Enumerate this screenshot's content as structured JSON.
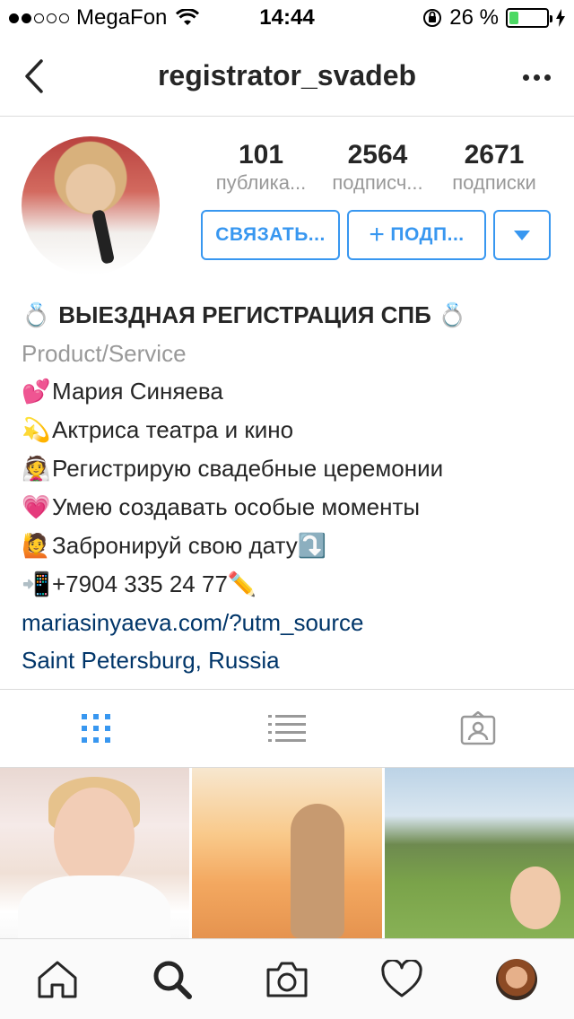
{
  "status_bar": {
    "carrier": "MegaFon",
    "signal_bars_filled": 2,
    "signal_bars_total": 5,
    "time": "14:44",
    "battery_percent_text": "26 %",
    "battery_level": 0.26,
    "battery_color": "#4cd964"
  },
  "nav": {
    "title": "registrator_svadeb",
    "back_icon": "chevron-left-icon",
    "more_icon": "more-horizontal-icon"
  },
  "profile": {
    "stats": [
      {
        "value": "101",
        "label": "публика..."
      },
      {
        "value": "2564",
        "label": "подписч..."
      },
      {
        "value": "2671",
        "label": "подписки"
      }
    ],
    "contact_button": "СВЯЗАТЬ...",
    "follow_button": "ПОДП...",
    "follow_plus": "+",
    "accent_color": "#3897f0"
  },
  "bio": {
    "name": "ВЫЕЗДНАЯ РЕГИСТРАЦИЯ СПБ",
    "name_emoji": "💍",
    "category": "Product/Service",
    "lines": [
      {
        "emoji": "💕",
        "text": "Мария Синяева"
      },
      {
        "emoji": "💫",
        "text": "Актриса театра и кино"
      },
      {
        "emoji": "👰",
        "text": "Регистрирую свадебные церемонии"
      },
      {
        "emoji": "💗",
        "text": "Умею создавать особые моменты"
      },
      {
        "emoji": "🙋",
        "text": "Забронируй свою дату",
        "suffix": "⤵️"
      },
      {
        "emoji": "📲",
        "text": "+7904 335 24 77",
        "suffix": "✏️"
      }
    ],
    "website": "mariasinyaeva.com/?utm_source",
    "location": "Saint Petersburg, Russia",
    "link_color": "#003569"
  },
  "tabs": [
    {
      "icon": "grid-icon",
      "active": true
    },
    {
      "icon": "list-icon",
      "active": false
    },
    {
      "icon": "tagged-photos-icon",
      "active": false
    }
  ],
  "tabbar": [
    {
      "icon": "home-icon"
    },
    {
      "icon": "search-icon",
      "active": true
    },
    {
      "icon": "camera-icon"
    },
    {
      "icon": "heart-icon"
    },
    {
      "icon": "profile-avatar-icon"
    }
  ]
}
